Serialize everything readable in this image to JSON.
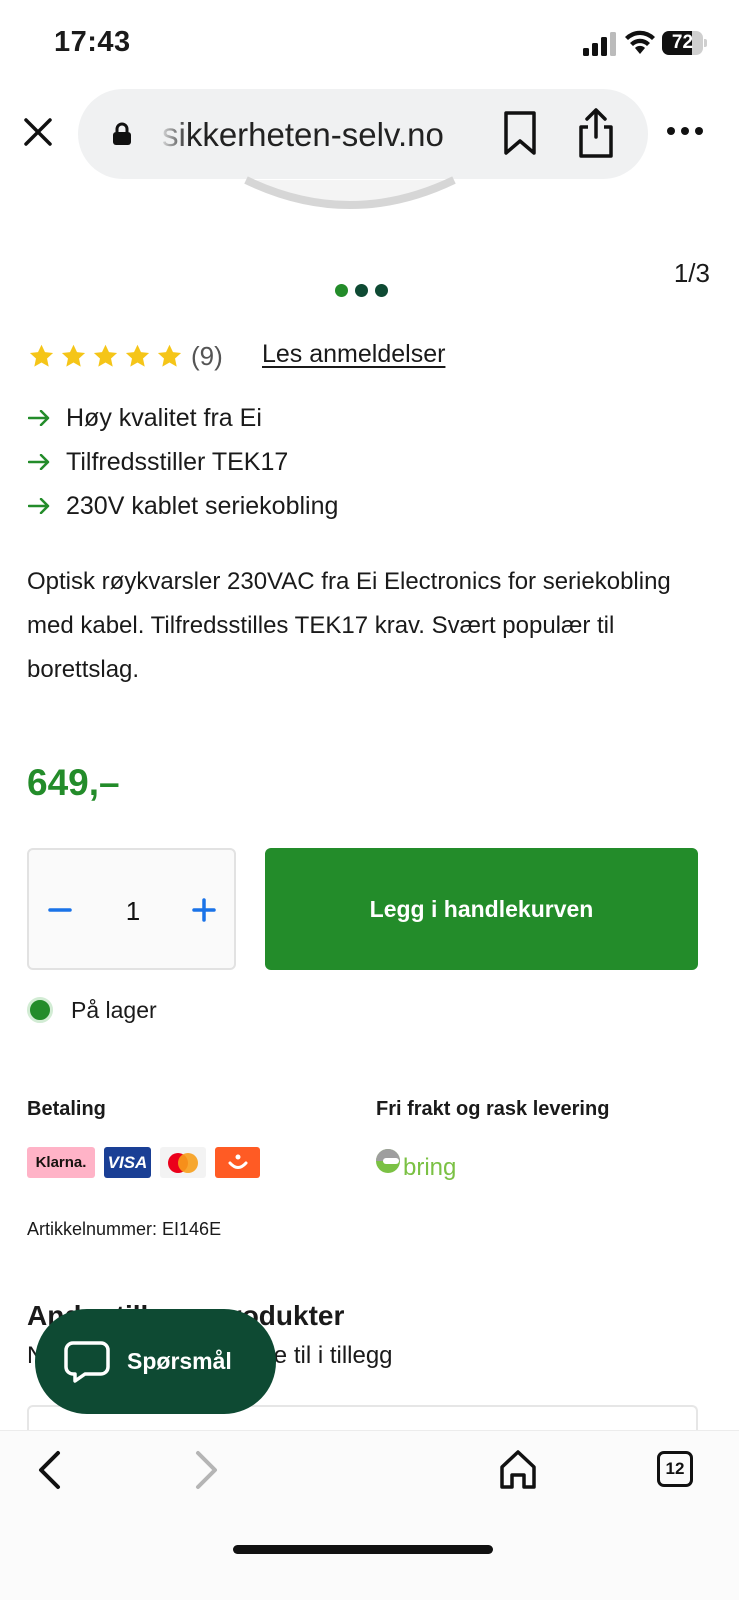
{
  "status_bar": {
    "time": "17:43",
    "battery": "72",
    "battery_level": 0.72
  },
  "browser": {
    "url": "sikkerheten-selv.no"
  },
  "carousel": {
    "counter": "1/3",
    "active_dot": 0,
    "dot_count": 3
  },
  "rating": {
    "stars": 5,
    "count": "(9)",
    "reviews_link": "Les anmeldelser"
  },
  "features": [
    "Høy kvalitet fra Ei",
    "Tilfredsstiller TEK17",
    "230V kablet seriekobling"
  ],
  "description": "Optisk røykvarsler 230VAC fra Ei Electronics for seriekobling med kabel. Tilfredsstilles TEK17 krav. Svært populær til borettslag.",
  "price": "649,–",
  "quantity": {
    "value": "1"
  },
  "add_to_cart": "Legg i handlekurven",
  "stock": "På lager",
  "payment": {
    "title": "Betaling",
    "klarna": "Klarna.",
    "visa": "VISA"
  },
  "delivery": {
    "title": "Fri frakt og rask levering",
    "carrier": "bring"
  },
  "article_number": "Artikkelnummer: EI146E",
  "related": {
    "title": "Andre tilleggsprodukter",
    "subtitle": "Noe du kanskje vil legge til i tillegg"
  },
  "chat": {
    "label": "Spørsmål"
  },
  "toolbar": {
    "tabs_count": "12"
  },
  "colors": {
    "brand_green": "#238c2a",
    "dark_green": "#0e4a33",
    "star": "#f5c518"
  },
  "icons": [
    "close-icon",
    "lock-icon",
    "bookmark-icon",
    "share-icon",
    "more-icon",
    "star-icon",
    "arrow-right-icon",
    "minus-icon",
    "plus-icon",
    "chat-icon",
    "back-icon",
    "forward-icon",
    "home-icon",
    "tabs-icon"
  ]
}
